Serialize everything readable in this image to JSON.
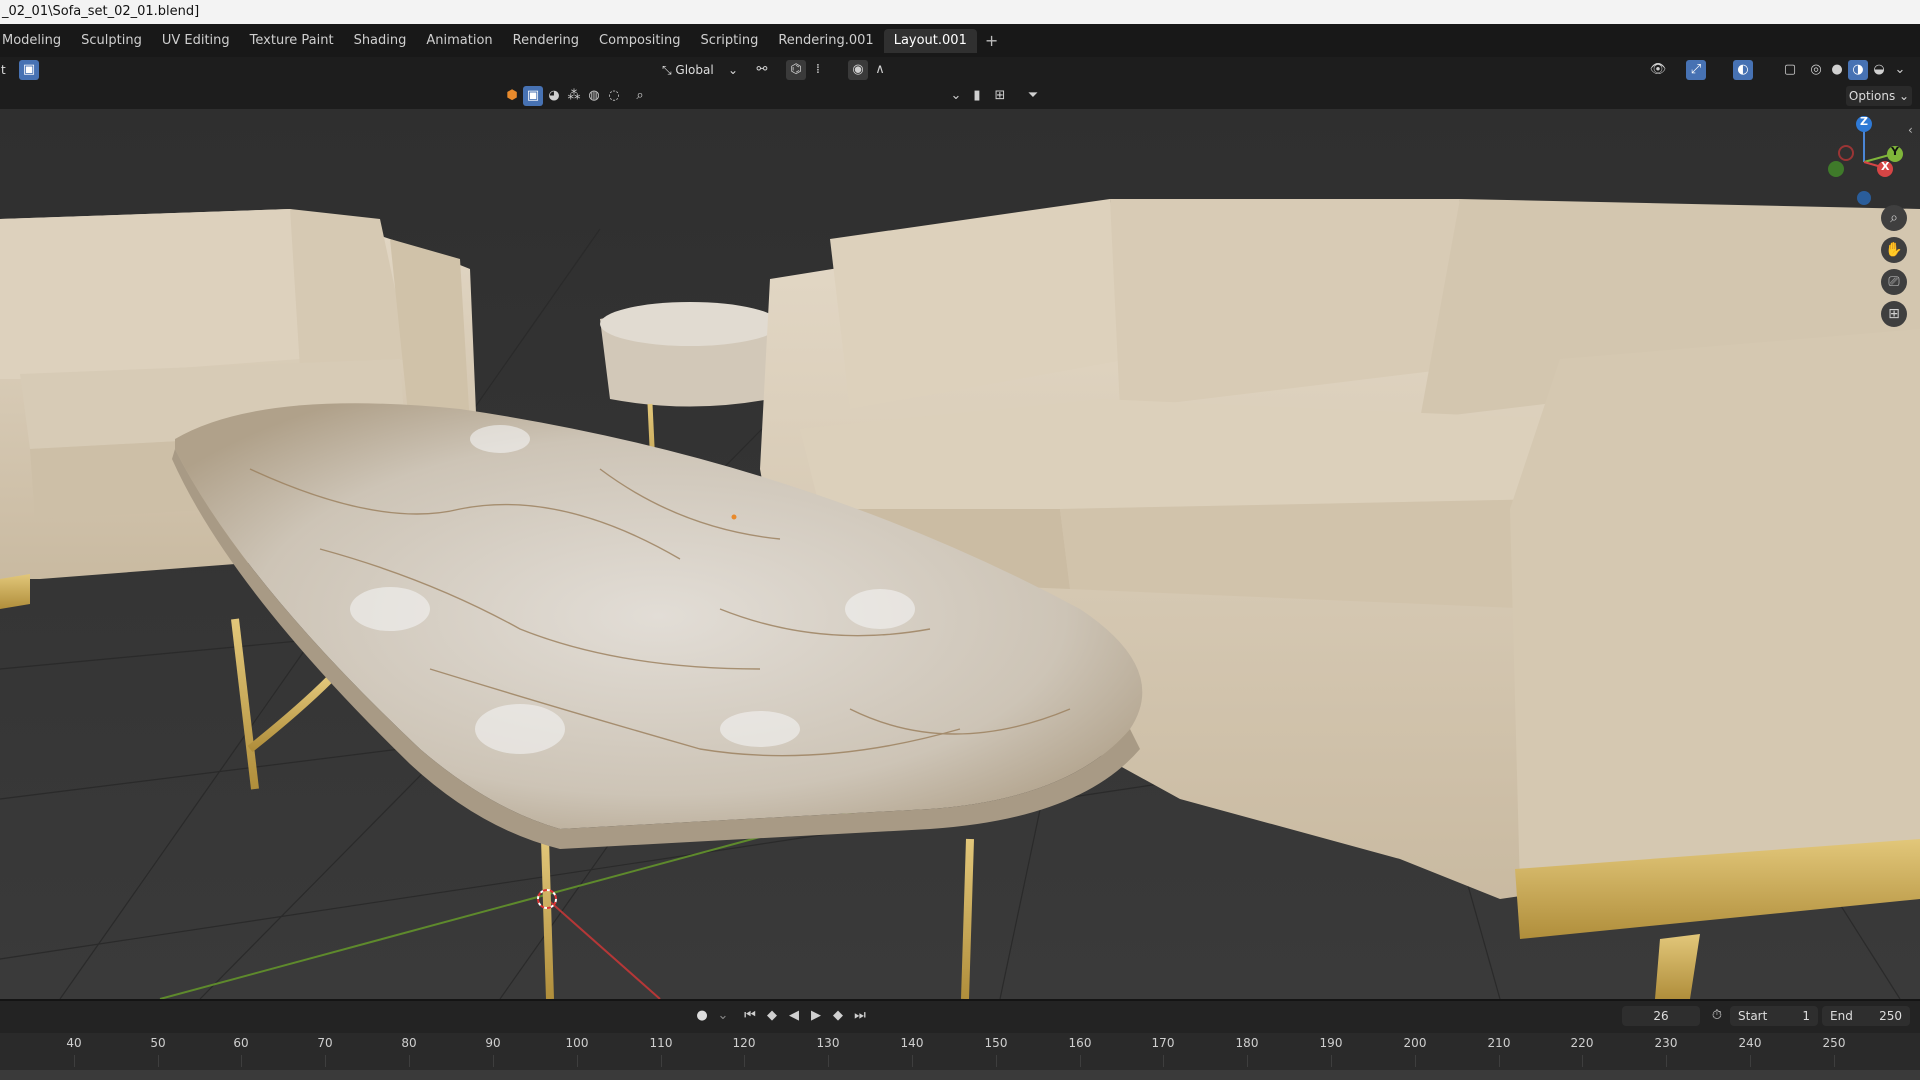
{
  "window": {
    "title": "_02_01\\Sofa_set_02_01.blend]"
  },
  "workspaces": [
    "Modeling",
    "Sculpting",
    "UV Editing",
    "Texture Paint",
    "Shading",
    "Animation",
    "Rendering",
    "Compositing",
    "Scripting",
    "Rendering.001",
    "Layout.001"
  ],
  "active_workspace": "Layout.001",
  "add_workspace": "+",
  "header": {
    "left_char": "t",
    "orientation": "Global",
    "options_label": "Options"
  },
  "search": {
    "placeholder": ""
  },
  "gizmo": {
    "z_label": "Z",
    "y_label": "Y",
    "x_label": "X"
  },
  "timeline": {
    "current_frame": "26",
    "start_label": "Start",
    "start_value": "1",
    "end_label": "End",
    "end_value": "250"
  },
  "ruler": {
    "ticks": [
      "40",
      "50",
      "60",
      "70",
      "80",
      "90",
      "100",
      "110",
      "120",
      "130",
      "140",
      "150",
      "160",
      "170",
      "180",
      "190",
      "200",
      "210",
      "220",
      "230",
      "240",
      "250"
    ]
  },
  "colors": {
    "accent": "#4772b3",
    "gold": "#c9a94a",
    "fabric": "#d8cbb5",
    "marble": "#cfc7bb"
  }
}
